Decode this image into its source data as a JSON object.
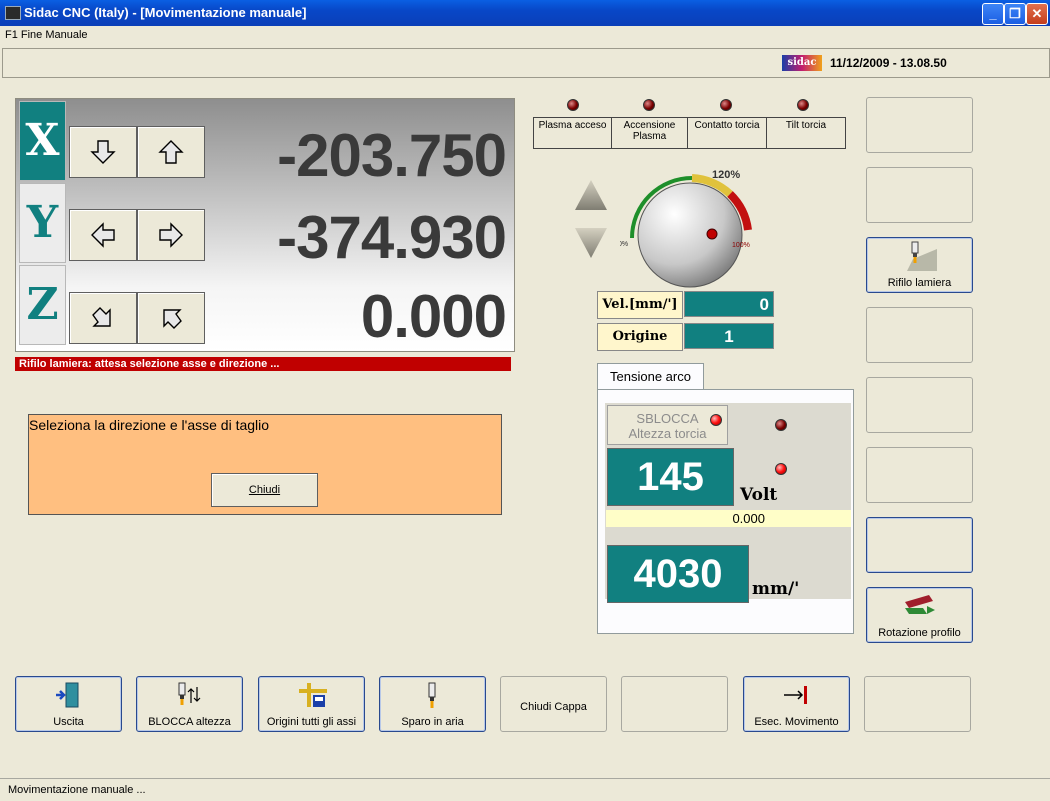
{
  "window": {
    "title": "Sidac CNC (Italy) - [Movimentazione manuale]"
  },
  "menu": {
    "item": "F1 Fine Manuale"
  },
  "header": {
    "logo_text": "sidac",
    "datetime": "11/12/2009 -  13.08.50"
  },
  "axes": [
    {
      "label": "X",
      "value": "-203.750",
      "selected": true
    },
    {
      "label": "Y",
      "value": "-374.930",
      "selected": false
    },
    {
      "label": "Z",
      "value": "0.000",
      "selected": false
    }
  ],
  "status_red": "Rifilo lamiera: attesa selezione asse e direzione ...",
  "message": {
    "text": "Seleziona la direzione e l'asse di taglio",
    "button": "Chiudi"
  },
  "indicators": [
    {
      "label": "Plasma acceso",
      "on": false
    },
    {
      "label": "Accensione Plasma",
      "on": false
    },
    {
      "label": "Contatto torcia",
      "on": false
    },
    {
      "label": "Tilt torcia",
      "on": false
    }
  ],
  "knob": {
    "max_label": "120%",
    "min_label": "0%",
    "mid_label": "100%"
  },
  "fields": {
    "vel_label": "Vel.[mm/']",
    "vel_value": "0",
    "origine_label": "Origine",
    "origine_value": "1"
  },
  "arc": {
    "tab": "Tensione arco",
    "sblocca_line1": "SBLOCCA",
    "sblocca_line2": "Altezza torcia",
    "volt_value": "145",
    "volt_unit": "Volt",
    "yellow_value": "0.000",
    "speed_value": "4030",
    "speed_unit": "mm/'"
  },
  "right_buttons": {
    "rifilo": "Rifilo lamiera",
    "rotazione": "Rotazione profilo"
  },
  "bottom_buttons": [
    {
      "label": "Uscita"
    },
    {
      "label": "BLOCCA altezza"
    },
    {
      "label": "Origini tutti gli assi"
    },
    {
      "label": "Sparo in aria"
    },
    {
      "label": "Chiudi Cappa"
    },
    {
      "label": ""
    },
    {
      "label": "Esec. Movimento"
    },
    {
      "label": ""
    }
  ],
  "statusbar": "Movimentazione manuale ..."
}
